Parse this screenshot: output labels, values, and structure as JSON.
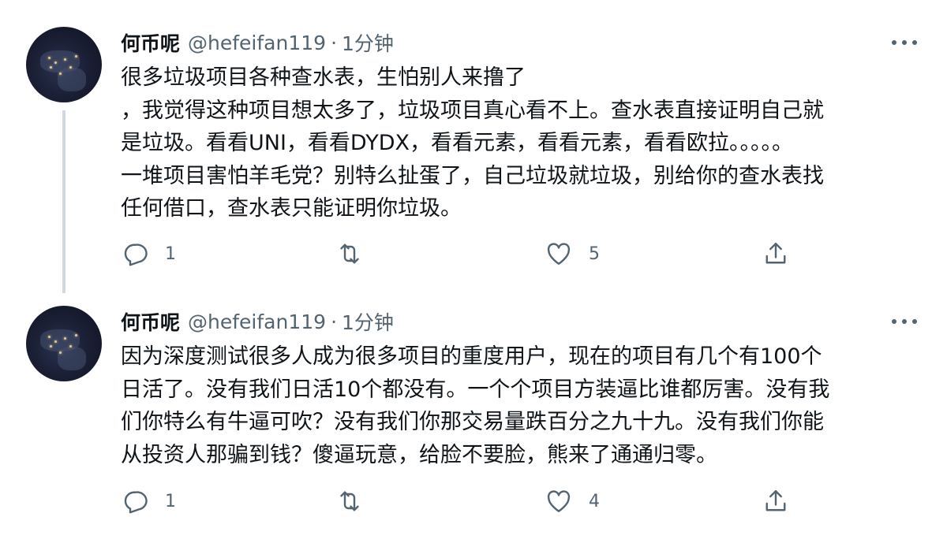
{
  "tweets": [
    {
      "author_name": "何币呢",
      "handle": "@hefeifan119",
      "separator": "·",
      "time": "1分钟",
      "lines": [
        "很多垃圾项目各种查水表，生怕别人来撸了",
        "，我觉得这种项目想太多了，垃圾项目真心看不上。查水表直接证明自己就",
        "是垃圾。看看UNI，看看DYDX，看看元素，看看元素，看看欧拉。。。。。",
        "一堆项目害怕羊毛党？别特么扯蛋了，自己垃圾就垃圾，别给你的查水表找",
        "任何借口，查水表只能证明你垃圾。"
      ],
      "reply_count": "1",
      "retweet_count": "",
      "like_count": "5"
    },
    {
      "author_name": "何币呢",
      "handle": "@hefeifan119",
      "separator": "·",
      "time": "1分钟",
      "lines": [
        "因为深度测试很多人成为很多项目的重度用户，现在的项目有几个有100个",
        "日活了。没有我们日活10个都没有。一个个项目方装逼比谁都厉害。没有我",
        "们你特么有牛逼可吹？没有我们你那交易量跌百分之九十九。没有我们你能",
        "从投资人那骗到钱？傻逼玩意，给脸不要脸，熊来了通通归零。"
      ],
      "reply_count": "1",
      "retweet_count": "",
      "like_count": "4"
    }
  ],
  "icons": {
    "reply": "reply-icon",
    "retweet": "retweet-icon",
    "like": "heart-icon",
    "share": "share-icon",
    "more": "more-icon"
  },
  "colors": {
    "text": "#0f1419",
    "secondary": "#536471",
    "thread_line": "#cfd9de"
  }
}
